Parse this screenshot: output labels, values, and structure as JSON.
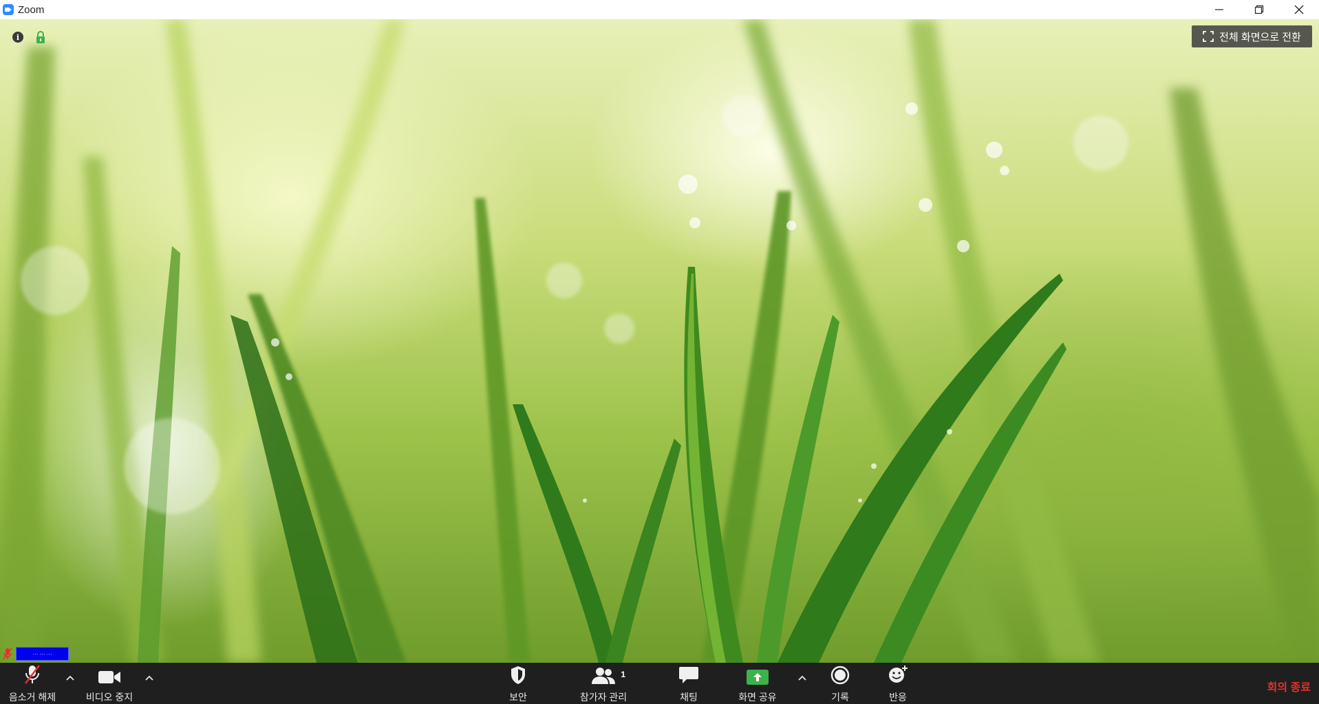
{
  "window": {
    "title": "Zoom",
    "controls": [
      "minimize-icon",
      "restore-icon",
      "close-icon"
    ]
  },
  "meeting": {
    "fullscreen_label": "전체 화면으로 전환",
    "info_icon": "info-icon",
    "lock_icon": "lock-icon",
    "participant_name": "··· ··· ···",
    "participant_audio": "muted"
  },
  "toolbar": {
    "unmute_label": "음소거 해제",
    "video_label": "비디오 중지",
    "security_label": "보안",
    "participants_label": "참가자 관리",
    "participants_count": "1",
    "chat_label": "채팅",
    "share_label": "화면 공유",
    "record_label": "기록",
    "reactions_label": "반응",
    "end_label": "회의 종료"
  },
  "colors": {
    "toolbar_bg": "#1f1f1f",
    "share_green": "#3cb34a",
    "end_red": "#e5312b",
    "zoom_blue": "#2D8CFF",
    "name_tag_blue": "#0000f0"
  }
}
